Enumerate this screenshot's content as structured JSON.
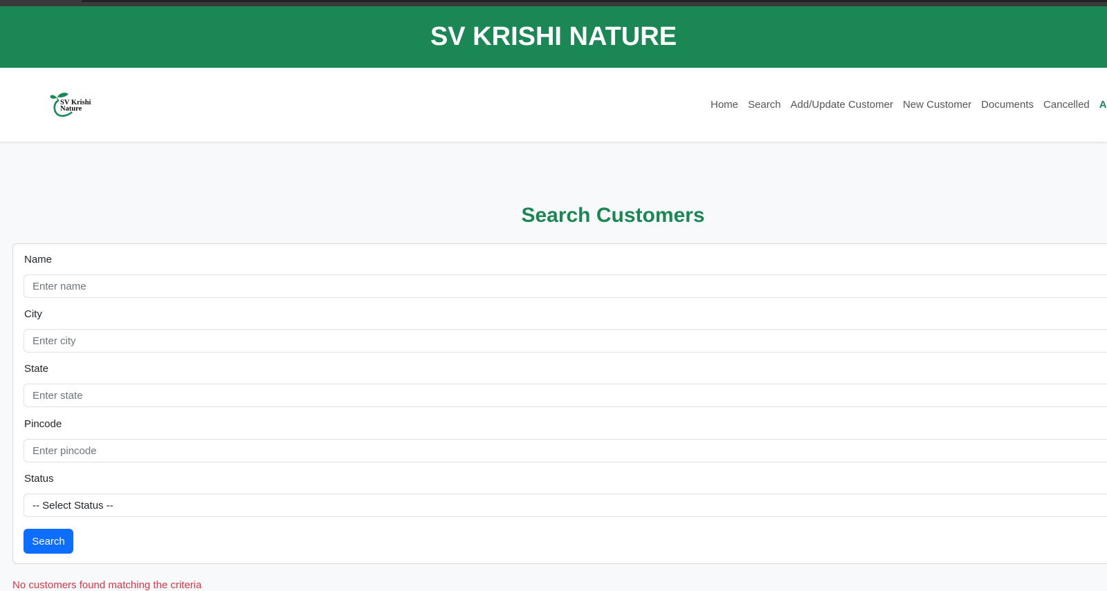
{
  "banner": {
    "title": "SV KRISHI NATURE"
  },
  "brand": {
    "logo_text_line1": "SV Krishi",
    "logo_text_line2": "Nature",
    "accent_color": "#1b8754"
  },
  "nav": {
    "items": [
      {
        "label": "Home"
      },
      {
        "label": "Search"
      },
      {
        "label": "Add/Update Customer"
      },
      {
        "label": "New Customer"
      },
      {
        "label": "Documents"
      },
      {
        "label": "Cancelled"
      },
      {
        "label": "Al"
      }
    ]
  },
  "page": {
    "title": "Search Customers"
  },
  "form": {
    "name": {
      "label": "Name",
      "placeholder": "Enter name",
      "value": ""
    },
    "city": {
      "label": "City",
      "placeholder": "Enter city",
      "value": ""
    },
    "state": {
      "label": "State",
      "placeholder": "Enter state",
      "value": ""
    },
    "pincode": {
      "label": "Pincode",
      "placeholder": "Enter pincode",
      "value": ""
    },
    "status": {
      "label": "Status",
      "selected": "-- Select Status --"
    },
    "search_button": "Search"
  },
  "results": {
    "message": "No customers found matching the criteria",
    "message_color": "#dc3545"
  }
}
